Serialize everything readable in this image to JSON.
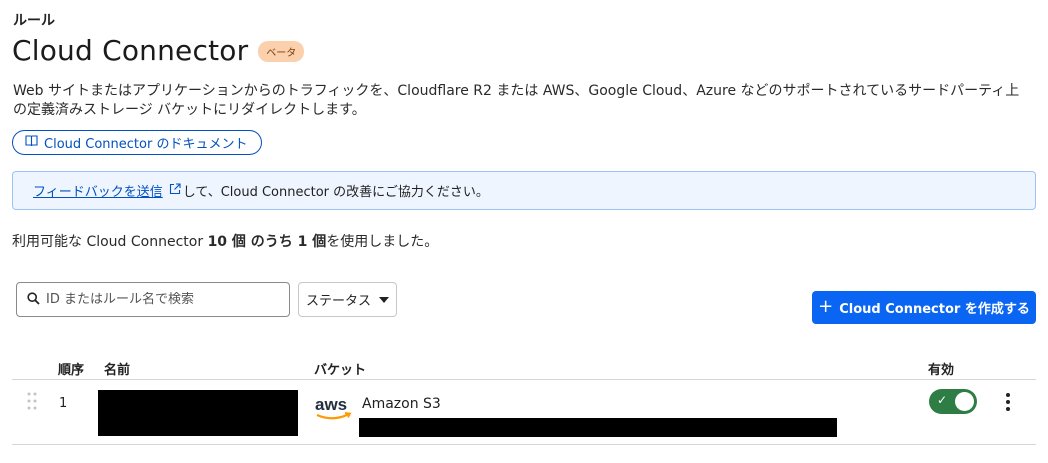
{
  "breadcrumb": "ルール",
  "page_title": "Cloud Connector",
  "beta_badge": "ベータ",
  "description": "Web サイトまたはアプリケーションからのトラフィックを、Cloudflare R2 または AWS、Google Cloud、Azure などのサポートされているサードパーティ上の定義済みストレージ バケットにリダイレクトします。",
  "doc_link": {
    "label": "Cloud Connector のドキュメント",
    "icon": "book-icon"
  },
  "feedback": {
    "link_text": "フィードバックを送信",
    "rest_text": "して、Cloud Connector の改善にご協力ください。",
    "icon": "external-link-icon"
  },
  "usage": {
    "prefix": "利用可能な Cloud Connector ",
    "total": "10 個",
    "middle": " のうち ",
    "used": "1 個",
    "suffix": "を使用しました。"
  },
  "search": {
    "placeholder": "ID またはルール名で検索",
    "icon": "search-icon"
  },
  "status_filter": {
    "label": "ステータス",
    "icon": "caret-down-icon"
  },
  "create_button": {
    "label": "Cloud Connector を作成する",
    "icon": "plus-icon"
  },
  "table": {
    "headers": {
      "order": "順序",
      "name": "名前",
      "bucket": "バケット",
      "enabled": "有効"
    },
    "rows": [
      {
        "order": "1",
        "bucket_provider": "Amazon S3",
        "enabled": true
      }
    ]
  },
  "colors": {
    "accent": "#0a66f2",
    "link": "#0051c3",
    "toggle_on": "#2e7d44",
    "beta_bg": "#fbd1ad",
    "feedback_bg": "#eef5fe"
  }
}
